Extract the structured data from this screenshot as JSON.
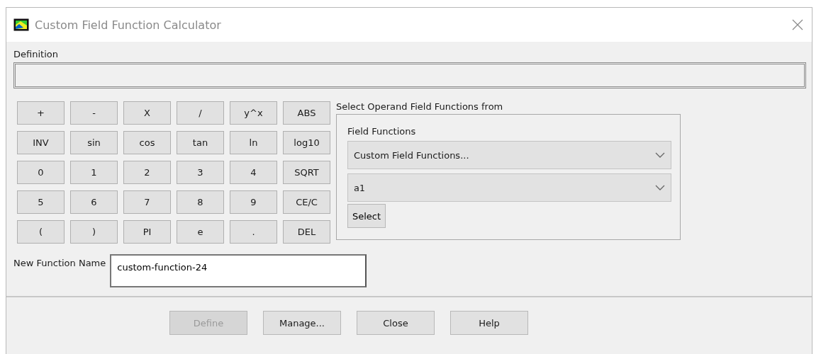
{
  "window": {
    "title": "Custom Field Function Calculator"
  },
  "definition": {
    "label": "Definition"
  },
  "keypad": [
    [
      "+",
      "-",
      "X",
      "/",
      "y^x",
      "ABS"
    ],
    [
      "INV",
      "sin",
      "cos",
      "tan",
      "ln",
      "log10"
    ],
    [
      "0",
      "1",
      "2",
      "3",
      "4",
      "SQRT"
    ],
    [
      "5",
      "6",
      "7",
      "8",
      "9",
      "CE/C"
    ],
    [
      "(",
      ")",
      "PI",
      "e",
      ".",
      "DEL"
    ]
  ],
  "operand_group": {
    "title": "Select Operand Field Functions from",
    "label": "Field Functions",
    "category": "Custom Field Functions...",
    "function": "a1",
    "select_button": "Select"
  },
  "new_function_name": {
    "label": "New Function Name",
    "value": "custom-function-24"
  },
  "buttons": [
    {
      "label": "Define",
      "disabled": true
    },
    {
      "label": "Manage...",
      "disabled": false
    },
    {
      "label": "Close",
      "disabled": false
    },
    {
      "label": "Help",
      "disabled": false
    }
  ]
}
